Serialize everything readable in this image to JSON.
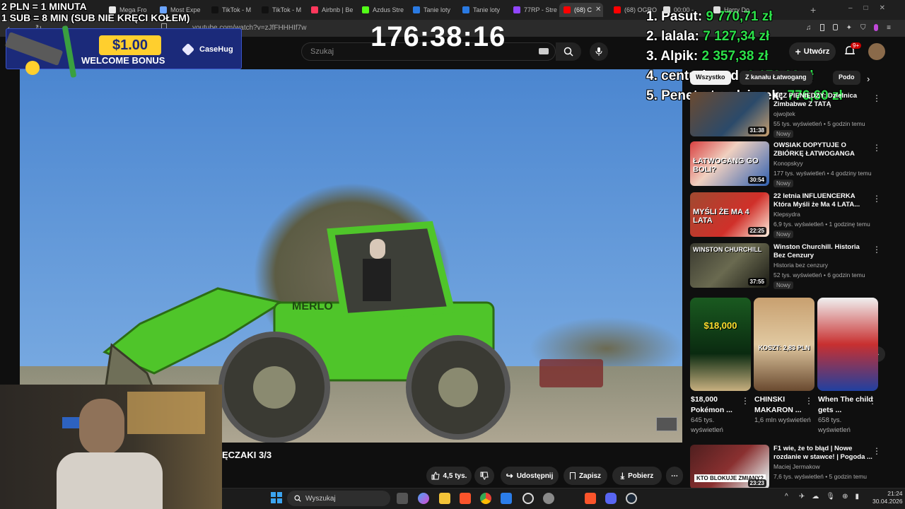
{
  "overlay": {
    "rules_line1": "2 PLN =  1 MINUTA",
    "rules_line2": "1 SUB = 8 MIN (SUB NIE KRĘCI KOŁEM)",
    "timer": "176:38:16",
    "ad": {
      "amount": "$1.00",
      "subtitle": "WELCOME BONUS",
      "brand": "CaseHug"
    },
    "leaderboard": [
      {
        "rank_name": "1. Pasut:",
        "amount": "9 770,71 zł"
      },
      {
        "rank_name": "2. lalala:",
        "amount": "7 127,34 zł"
      },
      {
        "rank_name": "3. Alpik:",
        "amount": "2 357,38 zł"
      },
      {
        "rank_name": "4. centurioond:",
        "amount": "2 173,08 zł"
      },
      {
        "rank_name": "5. Penetrator dziurek:",
        "amount": "776,60 zł"
      }
    ]
  },
  "browser": {
    "tabs": [
      {
        "label": "Mega Fro",
        "color": "#e8e8e8"
      },
      {
        "label": "Most Expe",
        "color": "#6aa4ff"
      },
      {
        "label": "TikTok - M",
        "color": "#111111"
      },
      {
        "label": "TikTok - M",
        "color": "#111111"
      },
      {
        "label": "Airbnb | Be",
        "color": "#ff385c"
      },
      {
        "label": "Azdus Stre",
        "color": "#53fc18"
      },
      {
        "label": "Tanie loty",
        "color": "#2a7ae2"
      },
      {
        "label": "Tanie loty",
        "color": "#2a7ae2"
      },
      {
        "label": "77RP - Stre",
        "color": "#9146ff"
      },
      {
        "label": "(68) C",
        "color": "#ff0000"
      },
      {
        "label": "(68) OGRO",
        "color": "#ff0000"
      },
      {
        "label": "00:00 - ",
        "color": "#dddddd"
      },
      {
        "label": "Harry Do",
        "color": "#dddddd"
      }
    ],
    "url": "youtube.com/watch?v=zJfFHHHIf7w"
  },
  "youtube": {
    "search_placeholder": "Szukaj",
    "create_label": "Utwórz",
    "notif_count": "9+",
    "video_title": "ĘCZAKI 3/3",
    "actions": {
      "likes": "4,5 tys.",
      "share": "Udostępnij",
      "save": "Zapisz",
      "download": "Pobierz"
    },
    "chips": [
      "Wszystko",
      "Z kanału Łatwogang",
      "Podo"
    ],
    "related": [
      {
        "title": "BEZ PIENIĘDZY: Dzielnica Zimbabwe Z TATĄ",
        "channel": "ojwojtek",
        "meta": "55 tys. wyświetleń • 5 godzin temu",
        "badge": "Nowy",
        "duration": "31:38"
      },
      {
        "title": "OWSIAK DOPYTUJE O ZBIÓRKĘ ŁATWOGANGA (GARGAMEL, ...",
        "channel": "Konopskyy",
        "meta": "177 tys. wyświetleń • 4 godziny temu",
        "badge": "Nowy",
        "duration": "30:54",
        "thumb_text": "ŁATWOGANG GO BOLI?"
      },
      {
        "title": "22 letnia INFLUENCERKA Która Myśli że Ma 4 LATA...",
        "channel": "Klepsydra",
        "meta": "6,9 tys. wyświetleń • 1 godzinę temu",
        "badge": "Nowy",
        "duration": "22:25",
        "thumb_text": "MYŚLI ŻE MA 4 LATA"
      },
      {
        "title": "Winston Churchill. Historia Bez Cenzury",
        "channel": "Historia bez cenzury",
        "meta": "52 tys. wyświetleń • 6 godzin temu",
        "badge": "Nowy",
        "duration": "37:55",
        "thumb_text": "WINSTON CHURCHILL"
      }
    ],
    "shorts": [
      {
        "title": "$18,000 Pokémon ...",
        "views": "645 tys. wyświetleń",
        "thumb_text": "$18,000"
      },
      {
        "title": "CHINSKI MAKARON ...",
        "views": "1,6 mln wyświetleń",
        "thumb_text": "KOSZT: 2,83 PLN"
      },
      {
        "title": "When The child gets ...",
        "views": "658 tys. wyświetleń"
      }
    ],
    "bottom_related": {
      "title": "F1 wie, że to błąd | Nowe rozdanie w stawce! | Pogoda ...",
      "channel": "Maciej Jermakow",
      "meta": "7,6 tys. wyświetleń • 5 godzin temu",
      "duration": "23:23",
      "thumb_text": "KTO BLOKUJE ZMIANY?"
    }
  },
  "taskbar": {
    "search_placeholder": "Wyszukaj",
    "time": "21:24",
    "date": "30.04.2026"
  },
  "colors": {
    "accent_green": "#2de04a",
    "yt_red": "#ff0000",
    "tractor_green": "#4fc52a"
  }
}
